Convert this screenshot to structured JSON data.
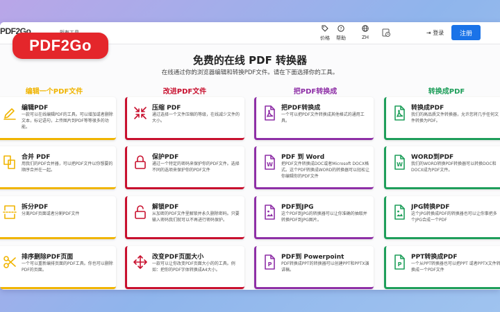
{
  "brand": {
    "small_logo": "PDF2Go",
    "badge": "PDF2Go",
    "nav_text": "所有工具"
  },
  "topnav": [
    {
      "label": "价格",
      "icon": "tag-icon"
    },
    {
      "label": "帮助",
      "icon": "help-icon"
    },
    {
      "label": "ZH",
      "icon": "globe-icon"
    },
    {
      "label": "",
      "icon": "history-icon"
    }
  ],
  "auth": {
    "login": "登录",
    "register": "注册"
  },
  "page": {
    "title": "免费的在线 PDF 转换器",
    "subtitle": "在线通过你的浏览器编辑和转换PDF文件。请在下面选择你的工具。"
  },
  "colors": {
    "yellow": "#f0b400",
    "red": "#c8102e",
    "purple": "#8e2fa6",
    "green": "#1e9e5a"
  },
  "columns": [
    {
      "header": "编辑一个PDF文件",
      "color": "#f0b400",
      "cards": [
        {
          "title": "编辑PDF",
          "desc": "一款可以在线编辑PDF的工具。可以增加或者删除文本，标记语句，上传图片到PDF等等很多的功能。",
          "icon": "edit-pencil-icon"
        },
        {
          "title": "合并 PDF",
          "desc": "用我们的PDF合并器，可以把PDF文件以你想要的顺序合并在一起。",
          "icon": "merge-files-icon"
        },
        {
          "title": "拆分PDF",
          "desc": "分离PDF页面或者分割PDF文件",
          "icon": "split-icon"
        },
        {
          "title": "排序删除PDF页面",
          "desc": "一个可以重新编排页面的PDF工具。你也可以删除PDF的页面。",
          "icon": "scissors-icon"
        }
      ]
    },
    {
      "header": "改进PDF文件",
      "color": "#c8102e",
      "cards": [
        {
          "title": "压缩 PDF",
          "desc": "通过选择一个文件压缩的等级，在线减少文件的大小。",
          "icon": "compress-icon"
        },
        {
          "title": "保护PDF",
          "desc": "通过一个特定的密码来保护你的PDF文件。选择不同的选项来保护你的PDF文件",
          "icon": "lock-icon"
        },
        {
          "title": "解锁PDF",
          "desc": "从加密的PDF文件里解锁并永久删除密码。只要输入密码我们就可以不再进行密码保护。",
          "icon": "unlock-icon"
        },
        {
          "title": "改变PDF页面大小",
          "desc": "一款可以让你改变PDF页面大小的的工具。例如：把你的PDF字体转换成A4大小。",
          "icon": "resize-arrows-icon"
        }
      ]
    },
    {
      "header": "把PDF转换成",
      "color": "#8e2fa6",
      "cards": [
        {
          "title": "把PDF转换成",
          "desc": "一个可以把PDF文件转换成其他格式的通用工具。",
          "icon": "pdf-file-icon"
        },
        {
          "title": "PDF 到 Word",
          "desc": "把PDF文件转换成DOC或者Microsoft DOCX格式。这个PDF转换成WORD的转换器可以轻松让你编辑你的PDF文件",
          "icon": "word-file-icon"
        },
        {
          "title": "PDF到JPG",
          "desc": "这个PDF到JPG的转换器可以让你准确的抽取并转换PDF到JPG图片。",
          "icon": "image-file-icon"
        },
        {
          "title": "PDF到 Powerpoint",
          "desc": "PDF转换成PPT的转换器可以创建PPT和PPTX演讲稿。",
          "icon": "powerpoint-file-icon"
        }
      ]
    },
    {
      "header": "转换成PDF",
      "color": "#1e9e5a",
      "cards": [
        {
          "title": "转换成PDF",
          "desc": "我们的高品质文件转换器，允许您将几乎任何文件转换为PDF。",
          "icon": "pdf-file-icon"
        },
        {
          "title": "WORD到PDF",
          "desc": "我们的WORD转换PDF转换器可以转换DOC和DOCX成为PDF文件。",
          "icon": "word-file-icon"
        },
        {
          "title": "JPG转换PDF",
          "desc": "这个JPG转换成PDF的转换器也可以让你事把多个JPG合成一个PDF",
          "icon": "image-file-icon"
        },
        {
          "title": "PPT转换成PDF",
          "desc": "一个从PPT转换器也可以把PPT 或者PPTX文件转换成一个PDF文件",
          "icon": "powerpoint-file-icon"
        }
      ]
    }
  ]
}
